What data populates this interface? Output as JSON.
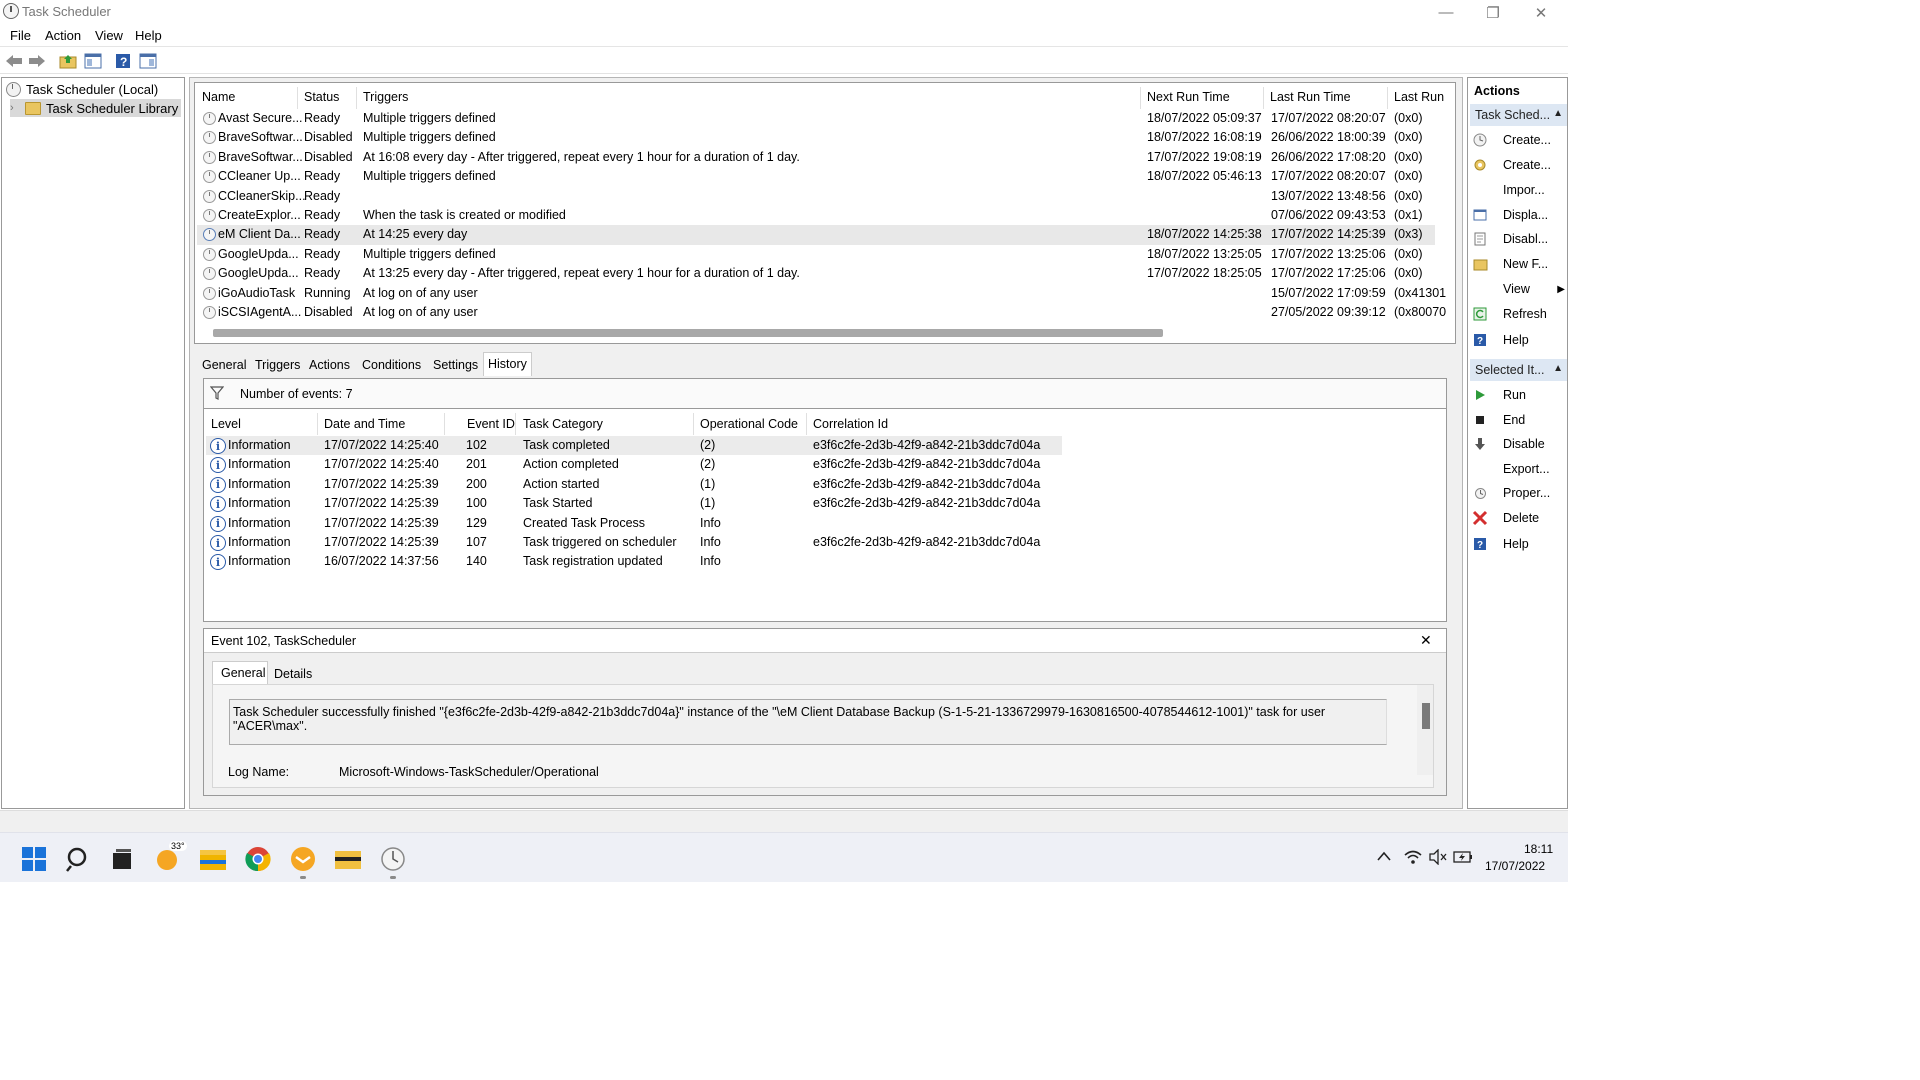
{
  "window": {
    "title": "Task Scheduler",
    "minimize_glyph": "—",
    "restore_glyph": "❐",
    "close_glyph": "✕"
  },
  "menu": [
    "File",
    "Action",
    "View",
    "Help"
  ],
  "toolbar": {
    "icons": [
      "back-arrow-icon",
      "forward-arrow-icon",
      "folder-up-icon",
      "show-hide-console-tree-icon",
      "help-icon",
      "show-hide-action-pane-icon"
    ]
  },
  "tree": {
    "root": "Task Scheduler (Local)",
    "library": "Task Scheduler Library",
    "expander": "›"
  },
  "tasks": {
    "columns": [
      "Name",
      "Status",
      "Triggers",
      "Next Run Time",
      "Last Run Time",
      "Last Run"
    ],
    "rows": [
      {
        "name": "Avast Secure...",
        "status": "Ready",
        "trigger": "Multiple triggers defined",
        "next": "18/07/2022 05:09:37",
        "last": "17/07/2022 08:20:07",
        "result": "(0x0)"
      },
      {
        "name": "BraveSoftwar...",
        "status": "Disabled",
        "trigger": "Multiple triggers defined",
        "next": "18/07/2022 16:08:19",
        "last": "26/06/2022 18:00:39",
        "result": "(0x0)"
      },
      {
        "name": "BraveSoftwar...",
        "status": "Disabled",
        "trigger": "At 16:08 every day - After triggered, repeat every 1 hour for a duration of 1 day.",
        "next": "17/07/2022 19:08:19",
        "last": "26/06/2022 17:08:20",
        "result": "(0x0)"
      },
      {
        "name": "CCleaner Up...",
        "status": "Ready",
        "trigger": "Multiple triggers defined",
        "next": "18/07/2022 05:46:13",
        "last": "17/07/2022 08:20:07",
        "result": "(0x0)"
      },
      {
        "name": "CCleanerSkip...",
        "status": "Ready",
        "trigger": "",
        "next": "",
        "last": "13/07/2022 13:48:56",
        "result": "(0x0)"
      },
      {
        "name": "CreateExplor...",
        "status": "Ready",
        "trigger": "When the task is created or modified",
        "next": "",
        "last": "07/06/2022 09:43:53",
        "result": "(0x1)"
      },
      {
        "name": "eM Client Da...",
        "status": "Ready",
        "trigger": "At 14:25 every day",
        "next": "18/07/2022 14:25:38",
        "last": "17/07/2022 14:25:39",
        "result": "(0x3)"
      },
      {
        "name": "GoogleUpda...",
        "status": "Ready",
        "trigger": "Multiple triggers defined",
        "next": "18/07/2022 13:25:05",
        "last": "17/07/2022 13:25:06",
        "result": "(0x0)"
      },
      {
        "name": "GoogleUpda...",
        "status": "Ready",
        "trigger": "At 13:25 every day - After triggered, repeat every 1 hour for a duration of 1 day.",
        "next": "17/07/2022 18:25:05",
        "last": "17/07/2022 17:25:06",
        "result": "(0x0)"
      },
      {
        "name": "iGoAudioTask",
        "status": "Running",
        "trigger": "At log on of any user",
        "next": "",
        "last": "15/07/2022 17:09:59",
        "result": "(0x41301"
      },
      {
        "name": "iSCSIAgentA...",
        "status": "Disabled",
        "trigger": "At log on of any user",
        "next": "",
        "last": "27/05/2022 09:39:12",
        "result": "(0x80070"
      }
    ]
  },
  "detail_tabs": [
    "General",
    "Triggers",
    "Actions",
    "Conditions",
    "Settings",
    "History"
  ],
  "history": {
    "events_label": "Number of events: 7",
    "columns": [
      "Level",
      "Date and Time",
      "Event ID",
      "Task Category",
      "Operational Code",
      "Correlation Id"
    ],
    "rows": [
      {
        "level": "Information",
        "date": "17/07/2022 14:25:40",
        "id": "102",
        "category": "Task completed",
        "opcode": "(2)",
        "corr": "e3f6c2fe-2d3b-42f9-a842-21b3ddc7d04a"
      },
      {
        "level": "Information",
        "date": "17/07/2022 14:25:40",
        "id": "201",
        "category": "Action completed",
        "opcode": "(2)",
        "corr": "e3f6c2fe-2d3b-42f9-a842-21b3ddc7d04a"
      },
      {
        "level": "Information",
        "date": "17/07/2022 14:25:39",
        "id": "200",
        "category": "Action started",
        "opcode": "(1)",
        "corr": "e3f6c2fe-2d3b-42f9-a842-21b3ddc7d04a"
      },
      {
        "level": "Information",
        "date": "17/07/2022 14:25:39",
        "id": "100",
        "category": "Task Started",
        "opcode": "(1)",
        "corr": "e3f6c2fe-2d3b-42f9-a842-21b3ddc7d04a"
      },
      {
        "level": "Information",
        "date": "17/07/2022 14:25:39",
        "id": "129",
        "category": "Created Task Process",
        "opcode": "Info",
        "corr": ""
      },
      {
        "level": "Information",
        "date": "17/07/2022 14:25:39",
        "id": "107",
        "category": "Task triggered on scheduler",
        "opcode": "Info",
        "corr": "e3f6c2fe-2d3b-42f9-a842-21b3ddc7d04a"
      },
      {
        "level": "Information",
        "date": "16/07/2022 14:37:56",
        "id": "140",
        "category": "Task registration updated",
        "opcode": "Info",
        "corr": ""
      }
    ]
  },
  "event": {
    "title": "Event 102, TaskScheduler",
    "close_glyph": "✕",
    "tabs": [
      "General",
      "Details"
    ],
    "message": "Task Scheduler successfully finished \"{e3f6c2fe-2d3b-42f9-a842-21b3ddc7d04a}\" instance of the \"\\eM Client Database Backup (S-1-5-21-1336729979-1630816500-4078544612-1001)\" task for user \"ACER\\max\".",
    "log_label": "Log Name:",
    "log_value": "Microsoft-Windows-TaskScheduler/Operational"
  },
  "actions": {
    "header": "Actions",
    "section1": "Task Sched...",
    "section1_items": [
      "Create...",
      "Create...",
      "Impor...",
      "Displa...",
      "Disabl...",
      "New F...",
      "View",
      "Refresh",
      "Help"
    ],
    "section2": "Selected It...",
    "section2_items": [
      "Run",
      "End",
      "Disable",
      "Export...",
      "Proper...",
      "Delete",
      "Help"
    ],
    "collapse_glyph": "▲",
    "submenu_glyph": "▶"
  },
  "taskbar": {
    "weather": "33°",
    "time": "18:11",
    "date": "17/07/2022",
    "apps": [
      "start-icon",
      "search-icon",
      "task-view-icon",
      "weather-icon",
      "file-explorer-icon",
      "chrome-icon",
      "em-client-icon",
      "folder-app-icon",
      "task-scheduler-icon"
    ],
    "tray": [
      "chevron-up-icon",
      "wifi-icon",
      "speaker-muted-icon",
      "battery-icon"
    ]
  },
  "colors": {
    "accent": "#2a5aa8",
    "selection": "#e8e8e8",
    "section_bg": "#dde7f3",
    "delete_red": "#d32f2f",
    "run_green": "#2e9a3a"
  }
}
